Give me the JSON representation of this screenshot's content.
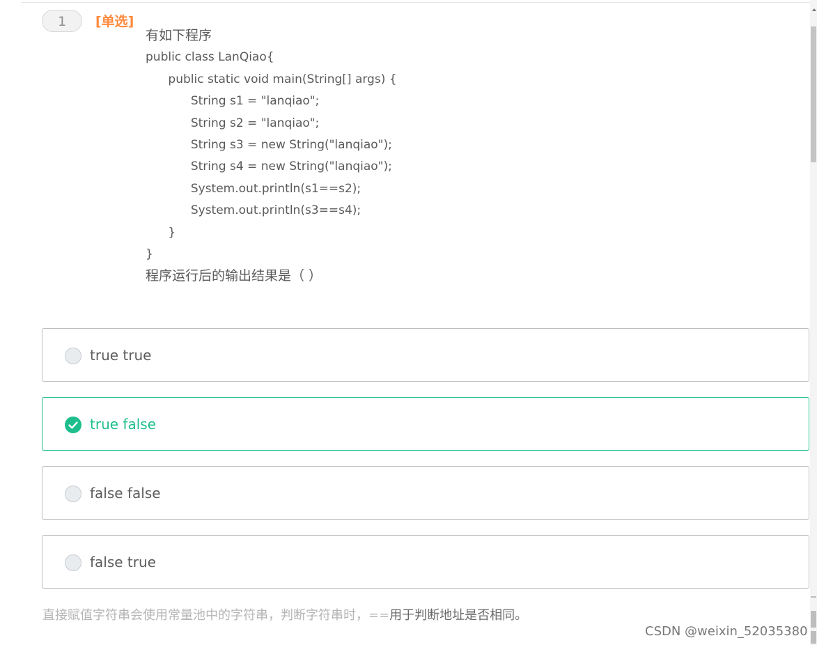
{
  "question": {
    "number": "1",
    "type_label": "[单选]",
    "lines": [
      "有如下程序",
      "public class LanQiao{",
      "      public static void main(String[] args) {",
      "            String s1 = \"lanqiao\";",
      "            String s2 = \"lanqiao\";",
      "            String s3 = new String(\"lanqiao\");",
      "            String s4 = new String(\"lanqiao\");",
      "            System.out.println(s1==s2);",
      "            System.out.println(s3==s4);",
      "      }",
      "}",
      "程序运行后的输出结果是（ ）"
    ]
  },
  "options": [
    {
      "label": "true true",
      "selected": false
    },
    {
      "label": "true false",
      "selected": true
    },
    {
      "label": "false false",
      "selected": false
    },
    {
      "label": "false true",
      "selected": false
    }
  ],
  "explanation": {
    "part1": "直接赋值字符串会使用常量池中的字符串，判断字符串时，==",
    "part2": "用于判断地址是否相同。"
  },
  "watermark": "CSDN @weixin_52035380",
  "colors": {
    "accent": "#1ebe8c",
    "type_label": "#ff8a3d"
  }
}
